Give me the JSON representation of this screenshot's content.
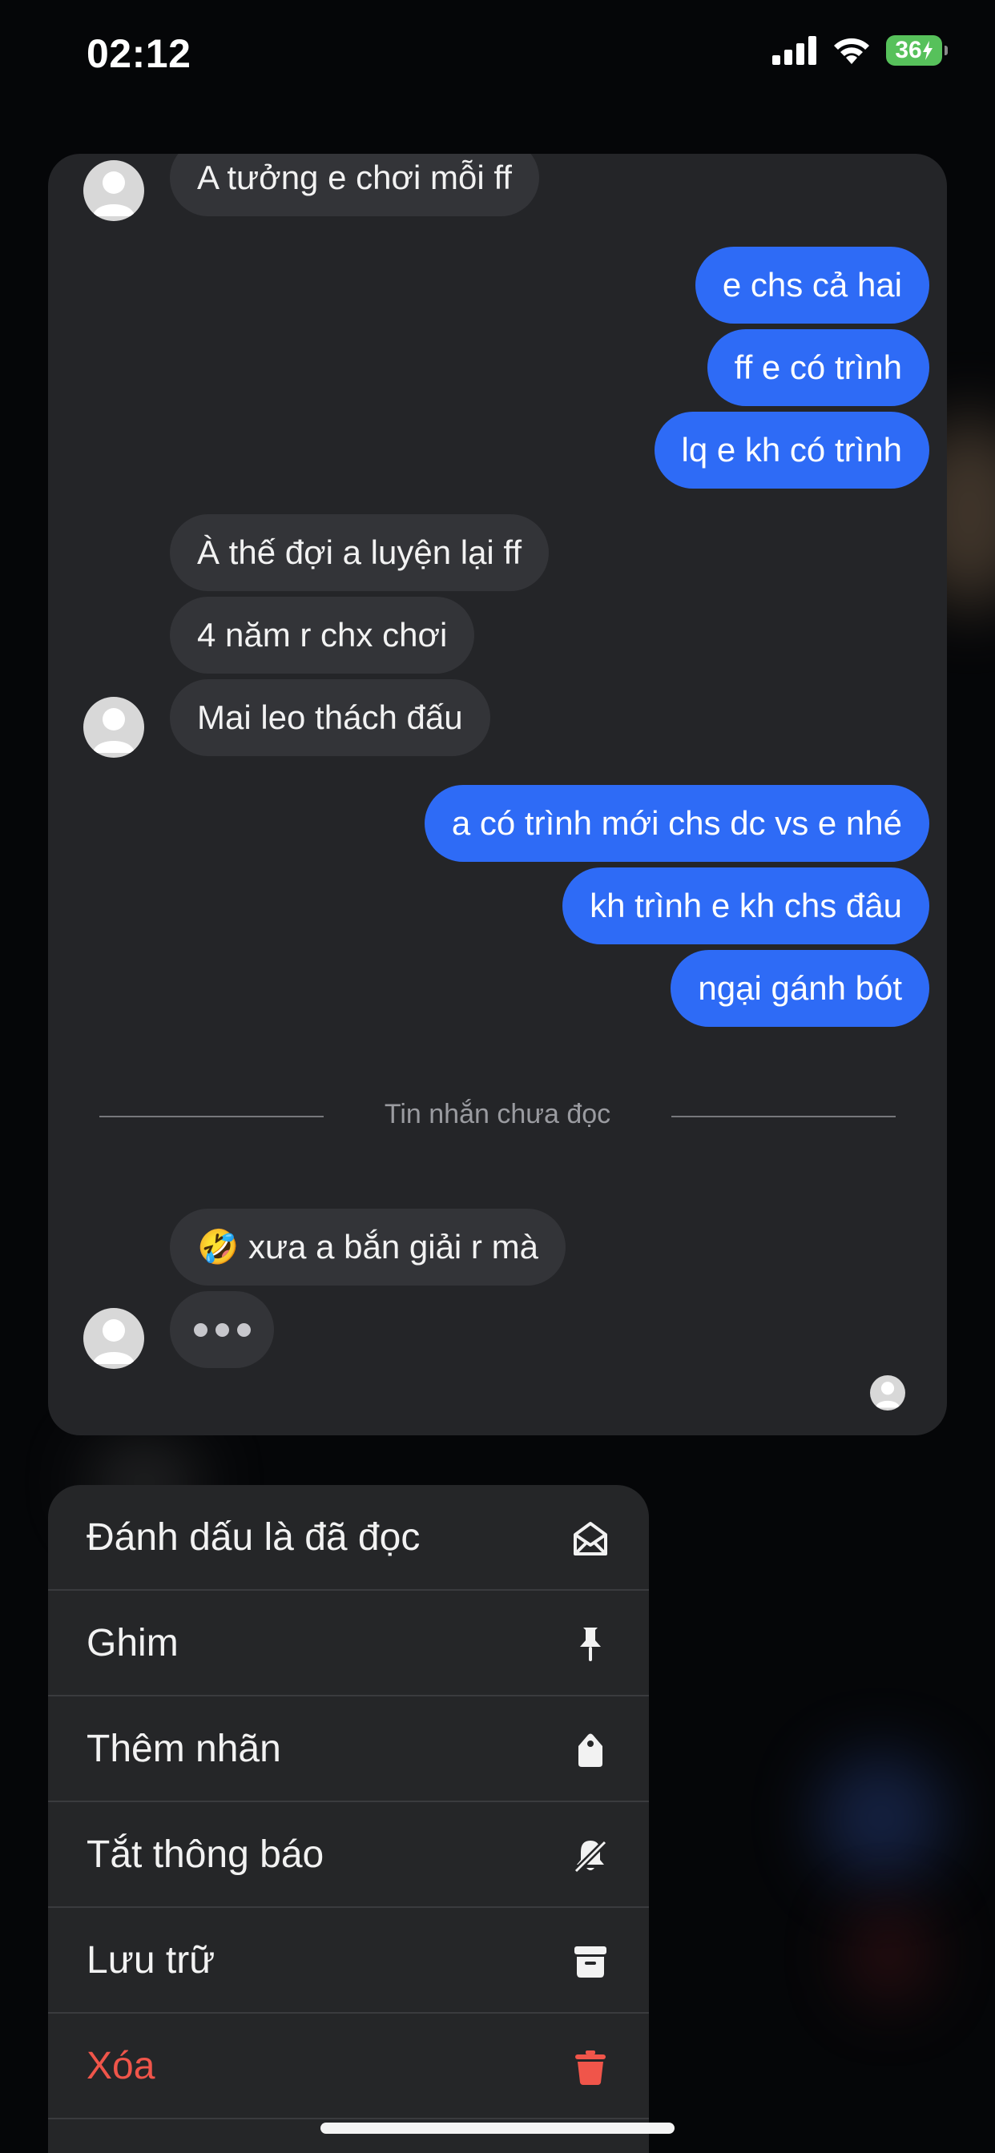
{
  "status_bar": {
    "time": "02:12",
    "battery": "36"
  },
  "chat": {
    "messages": [
      {
        "dir": "in",
        "text": "A tưởng e chơi mỗi ff"
      },
      {
        "dir": "out",
        "text": "e chs cả hai"
      },
      {
        "dir": "out",
        "text": "ff e có trình"
      },
      {
        "dir": "out",
        "text": "lq e kh có trình"
      },
      {
        "dir": "in",
        "text": "À thế đợi a luyện lại ff"
      },
      {
        "dir": "in",
        "text": "4 năm r chx chơi"
      },
      {
        "dir": "in",
        "text": "Mai leo thách đấu"
      },
      {
        "dir": "out",
        "text": "a có trình mới chs dc vs e nhé"
      },
      {
        "dir": "out",
        "text": "kh trình e kh chs đâu"
      },
      {
        "dir": "out",
        "text": "ngại gánh bót"
      },
      {
        "dir": "in",
        "text": "🤣 xưa a bắn giải r mà"
      }
    ],
    "unread_divider": "Tin nhắn chưa đọc"
  },
  "menu": {
    "items": [
      {
        "label": "Đánh dấu là đã đọc",
        "icon": "envelope-open-icon"
      },
      {
        "label": "Ghim",
        "icon": "pin-icon"
      },
      {
        "label": "Thêm nhãn",
        "icon": "tag-icon"
      },
      {
        "label": "Tắt thông báo",
        "icon": "bell-slash-icon"
      },
      {
        "label": "Lưu trữ",
        "icon": "archive-box-icon"
      },
      {
        "label": "Xóa",
        "icon": "trash-icon",
        "color": "#f0554a"
      }
    ]
  },
  "colors": {
    "outgoing_bubble": "#2e6bf6",
    "incoming_bubble": "#333438",
    "danger": "#f0554a"
  }
}
